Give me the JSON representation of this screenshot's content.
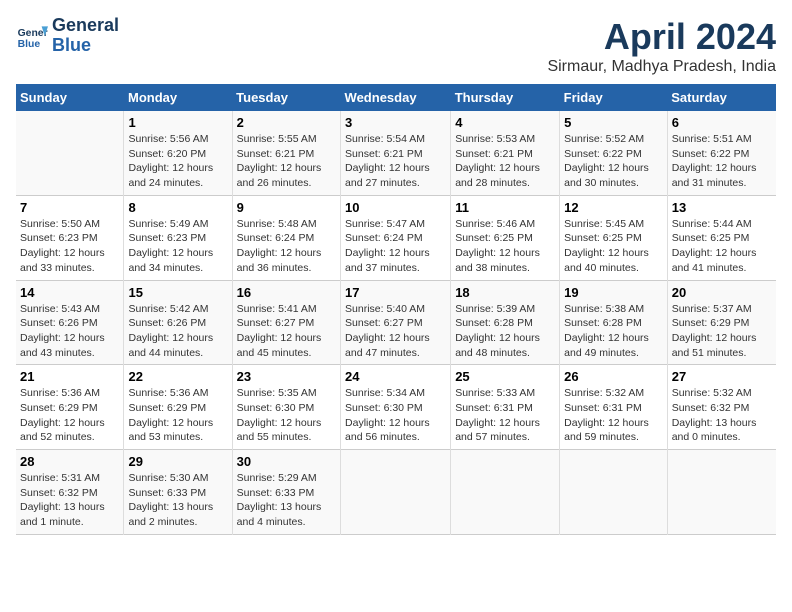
{
  "header": {
    "logo_line1": "General",
    "logo_line2": "Blue",
    "month": "April 2024",
    "location": "Sirmaur, Madhya Pradesh, India"
  },
  "days_of_week": [
    "Sunday",
    "Monday",
    "Tuesday",
    "Wednesday",
    "Thursday",
    "Friday",
    "Saturday"
  ],
  "weeks": [
    [
      {
        "day": "",
        "info": ""
      },
      {
        "day": "1",
        "info": "Sunrise: 5:56 AM\nSunset: 6:20 PM\nDaylight: 12 hours\nand 24 minutes."
      },
      {
        "day": "2",
        "info": "Sunrise: 5:55 AM\nSunset: 6:21 PM\nDaylight: 12 hours\nand 26 minutes."
      },
      {
        "day": "3",
        "info": "Sunrise: 5:54 AM\nSunset: 6:21 PM\nDaylight: 12 hours\nand 27 minutes."
      },
      {
        "day": "4",
        "info": "Sunrise: 5:53 AM\nSunset: 6:21 PM\nDaylight: 12 hours\nand 28 minutes."
      },
      {
        "day": "5",
        "info": "Sunrise: 5:52 AM\nSunset: 6:22 PM\nDaylight: 12 hours\nand 30 minutes."
      },
      {
        "day": "6",
        "info": "Sunrise: 5:51 AM\nSunset: 6:22 PM\nDaylight: 12 hours\nand 31 minutes."
      }
    ],
    [
      {
        "day": "7",
        "info": "Sunrise: 5:50 AM\nSunset: 6:23 PM\nDaylight: 12 hours\nand 33 minutes."
      },
      {
        "day": "8",
        "info": "Sunrise: 5:49 AM\nSunset: 6:23 PM\nDaylight: 12 hours\nand 34 minutes."
      },
      {
        "day": "9",
        "info": "Sunrise: 5:48 AM\nSunset: 6:24 PM\nDaylight: 12 hours\nand 36 minutes."
      },
      {
        "day": "10",
        "info": "Sunrise: 5:47 AM\nSunset: 6:24 PM\nDaylight: 12 hours\nand 37 minutes."
      },
      {
        "day": "11",
        "info": "Sunrise: 5:46 AM\nSunset: 6:25 PM\nDaylight: 12 hours\nand 38 minutes."
      },
      {
        "day": "12",
        "info": "Sunrise: 5:45 AM\nSunset: 6:25 PM\nDaylight: 12 hours\nand 40 minutes."
      },
      {
        "day": "13",
        "info": "Sunrise: 5:44 AM\nSunset: 6:25 PM\nDaylight: 12 hours\nand 41 minutes."
      }
    ],
    [
      {
        "day": "14",
        "info": "Sunrise: 5:43 AM\nSunset: 6:26 PM\nDaylight: 12 hours\nand 43 minutes."
      },
      {
        "day": "15",
        "info": "Sunrise: 5:42 AM\nSunset: 6:26 PM\nDaylight: 12 hours\nand 44 minutes."
      },
      {
        "day": "16",
        "info": "Sunrise: 5:41 AM\nSunset: 6:27 PM\nDaylight: 12 hours\nand 45 minutes."
      },
      {
        "day": "17",
        "info": "Sunrise: 5:40 AM\nSunset: 6:27 PM\nDaylight: 12 hours\nand 47 minutes."
      },
      {
        "day": "18",
        "info": "Sunrise: 5:39 AM\nSunset: 6:28 PM\nDaylight: 12 hours\nand 48 minutes."
      },
      {
        "day": "19",
        "info": "Sunrise: 5:38 AM\nSunset: 6:28 PM\nDaylight: 12 hours\nand 49 minutes."
      },
      {
        "day": "20",
        "info": "Sunrise: 5:37 AM\nSunset: 6:29 PM\nDaylight: 12 hours\nand 51 minutes."
      }
    ],
    [
      {
        "day": "21",
        "info": "Sunrise: 5:36 AM\nSunset: 6:29 PM\nDaylight: 12 hours\nand 52 minutes."
      },
      {
        "day": "22",
        "info": "Sunrise: 5:36 AM\nSunset: 6:29 PM\nDaylight: 12 hours\nand 53 minutes."
      },
      {
        "day": "23",
        "info": "Sunrise: 5:35 AM\nSunset: 6:30 PM\nDaylight: 12 hours\nand 55 minutes."
      },
      {
        "day": "24",
        "info": "Sunrise: 5:34 AM\nSunset: 6:30 PM\nDaylight: 12 hours\nand 56 minutes."
      },
      {
        "day": "25",
        "info": "Sunrise: 5:33 AM\nSunset: 6:31 PM\nDaylight: 12 hours\nand 57 minutes."
      },
      {
        "day": "26",
        "info": "Sunrise: 5:32 AM\nSunset: 6:31 PM\nDaylight: 12 hours\nand 59 minutes."
      },
      {
        "day": "27",
        "info": "Sunrise: 5:32 AM\nSunset: 6:32 PM\nDaylight: 13 hours\nand 0 minutes."
      }
    ],
    [
      {
        "day": "28",
        "info": "Sunrise: 5:31 AM\nSunset: 6:32 PM\nDaylight: 13 hours\nand 1 minute."
      },
      {
        "day": "29",
        "info": "Sunrise: 5:30 AM\nSunset: 6:33 PM\nDaylight: 13 hours\nand 2 minutes."
      },
      {
        "day": "30",
        "info": "Sunrise: 5:29 AM\nSunset: 6:33 PM\nDaylight: 13 hours\nand 4 minutes."
      },
      {
        "day": "",
        "info": ""
      },
      {
        "day": "",
        "info": ""
      },
      {
        "day": "",
        "info": ""
      },
      {
        "day": "",
        "info": ""
      }
    ]
  ]
}
